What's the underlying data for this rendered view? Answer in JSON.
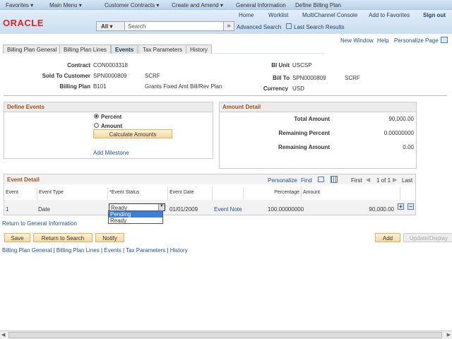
{
  "nav": {
    "favorites": "Favorites ▾",
    "main_menu": "Main Menu ▾",
    "crumbs": [
      "Customer Contracts ▾",
      "Create and Amend ▾",
      "General Information",
      "Define Billing Plan"
    ]
  },
  "header": {
    "links": [
      "Home",
      "Worklist",
      "MultiChannel Console",
      "Add to Favorites"
    ],
    "sign_out": "Sign out",
    "logo": "ORACLE",
    "search_scope": "All",
    "search_placeholder": "Search",
    "advanced_search": "Advanced Search",
    "last_search": "Last Search Results"
  },
  "pagelinks": {
    "new_window": "New Window",
    "help": "Help",
    "personalize": "Personalize Page"
  },
  "tabs": [
    "Billing Plan General",
    "Billing Plan Lines",
    "Events",
    "Tax Parameters",
    "History"
  ],
  "fields": {
    "contract_label": "Contract",
    "contract": "CON0003318",
    "sold_label": "Sold To Customer",
    "sold": "SPN0000809",
    "sold_name": "SCRF",
    "plan_label": "Billing Plan",
    "plan": "B101",
    "plan_desc": "Grants Fixed Amt Bill/Rev Plan",
    "bu_label": "Bl Unit",
    "bu": "USCSP",
    "billto_label": "Bill To",
    "billto": "SPN0000809",
    "billto_name": "SCRF",
    "cur_label": "Currency",
    "cur": "USD"
  },
  "define": {
    "title": "Define Events",
    "percent": "Percent",
    "amount": "Amount",
    "selected": "Percent",
    "calc": "Calculate Amounts",
    "add_milestone": "Add Milestone"
  },
  "amount": {
    "title": "Amount Detail",
    "total_label": "Total Amount",
    "total": "90,000.00",
    "rpct_label": "Remaining Percent",
    "rpct": "0.00000000",
    "ramt_label": "Remaining Amount",
    "ramt": "0.00"
  },
  "grid": {
    "title": "Event Detail",
    "personalize": "Personalize",
    "find": "Find",
    "first": "First",
    "count": "1 of 1",
    "last": "Last",
    "headers": [
      "Event",
      "Event Type",
      "*Event Status",
      "Event Date",
      "",
      "Percentage",
      "Amount"
    ],
    "row": {
      "event": "1",
      "type": "Date",
      "status": "Ready",
      "date": "01/01/2009",
      "note": "Event Note",
      "pct": "100.00000000",
      "amount": "90,000.00"
    },
    "options": [
      "Pending",
      "Ready"
    ]
  },
  "return_link": "Return to General Information",
  "buttons": {
    "save": "Save",
    "return": "Return to Search",
    "notify": "Notify",
    "add": "Add",
    "update": "Update/Display"
  },
  "footer": [
    "Billing Plan General",
    "Billing Plan Lines",
    "Events",
    "Tax Parameters",
    "History"
  ]
}
